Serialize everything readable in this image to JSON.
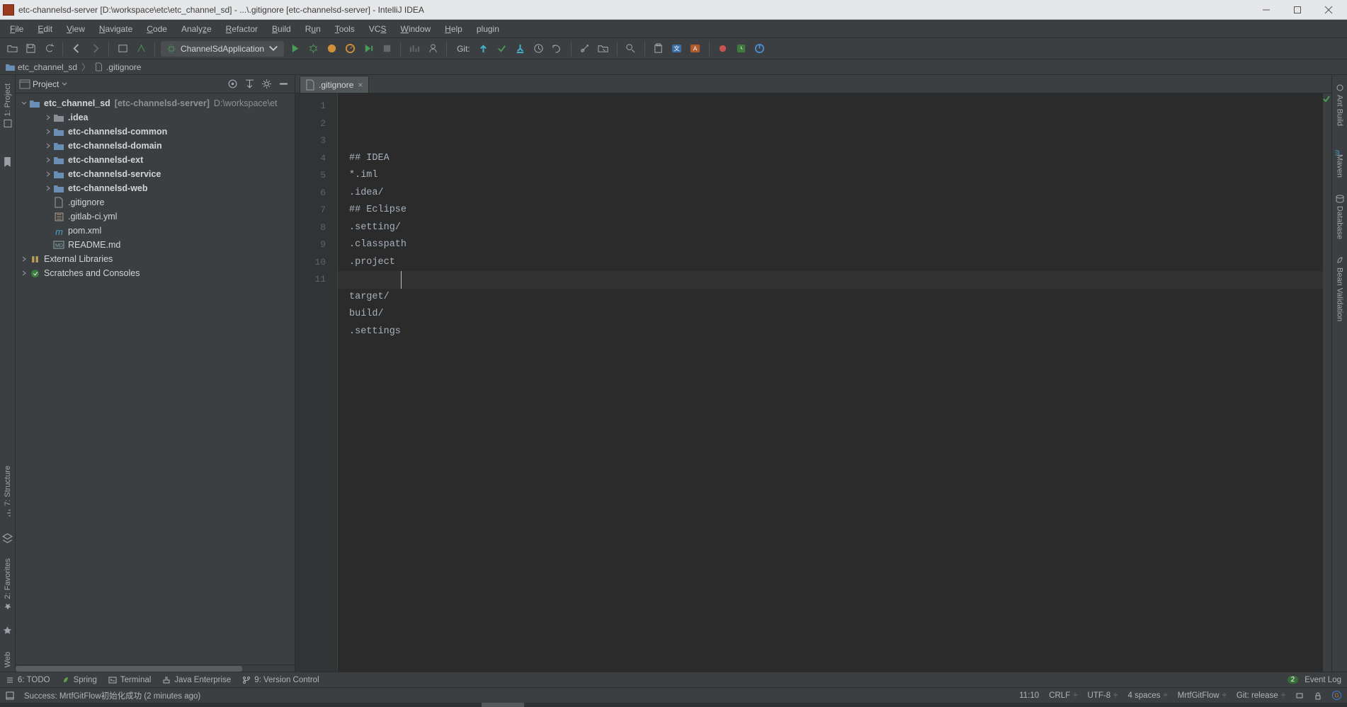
{
  "title": "etc-channelsd-server [D:\\workspace\\etc\\etc_channel_sd] - ...\\.gitignore [etc-channelsd-server] - IntelliJ IDEA",
  "menu": [
    "File",
    "Edit",
    "View",
    "Navigate",
    "Code",
    "Analyze",
    "Refactor",
    "Build",
    "Run",
    "Tools",
    "VCS",
    "Window",
    "Help",
    "plugin"
  ],
  "run_config": "ChannelSdApplication",
  "git_label": "Git:",
  "breadcrumbs": {
    "root": "etc_channel_sd",
    "file": ".gitignore"
  },
  "project_panel": {
    "title": "Project"
  },
  "tree": {
    "root": {
      "name": "etc_channel_sd",
      "bracket": "[etc-channelsd-server]",
      "path": "D:\\workspace\\et"
    },
    "children": [
      {
        "type": "folder",
        "name": ".idea"
      },
      {
        "type": "module",
        "name": "etc-channelsd-common"
      },
      {
        "type": "module",
        "name": "etc-channelsd-domain"
      },
      {
        "type": "module",
        "name": "etc-channelsd-ext"
      },
      {
        "type": "module",
        "name": "etc-channelsd-service"
      },
      {
        "type": "module",
        "name": "etc-channelsd-web"
      },
      {
        "type": "file",
        "name": ".gitignore",
        "icon": "txt"
      },
      {
        "type": "file",
        "name": ".gitlab-ci.yml",
        "icon": "yml"
      },
      {
        "type": "file",
        "name": "pom.xml",
        "icon": "maven"
      },
      {
        "type": "file",
        "name": "README.md",
        "icon": "md"
      }
    ],
    "siblings": [
      {
        "name": "External Libraries",
        "icon": "libs"
      },
      {
        "name": "Scratches and Consoles",
        "icon": "scratch"
      }
    ]
  },
  "editor": {
    "tab": ".gitignore",
    "lines": [
      "## IDEA",
      "*.iml",
      ".idea/",
      "## Eclipse",
      ".setting/",
      ".classpath",
      ".project",
      "",
      "target/",
      "build/",
      ".settings"
    ],
    "caret_line": 11,
    "caret_col": 10
  },
  "left_tools": {
    "project": "1: Project",
    "structure": "7: Structure",
    "favorites": "2: Favorites",
    "web": "Web"
  },
  "right_tools": {
    "ant": "Ant Build",
    "maven": "Maven",
    "database": "Database",
    "bean": "Bean Validation"
  },
  "bottom_tools": {
    "todo": "6: TODO",
    "spring": "Spring",
    "terminal": "Terminal",
    "jee": "Java Enterprise",
    "vcs": "9: Version Control",
    "event_log": "Event Log",
    "event_badge": "2"
  },
  "status": {
    "message": "Success: MrtfGitFlow初始化成功 (2 minutes ago)",
    "pos": "11:10",
    "eol": "CRLF",
    "encoding": "UTF-8",
    "indent": "4 spaces",
    "plugin": "MrtfGitFlow",
    "git": "Git: release"
  }
}
